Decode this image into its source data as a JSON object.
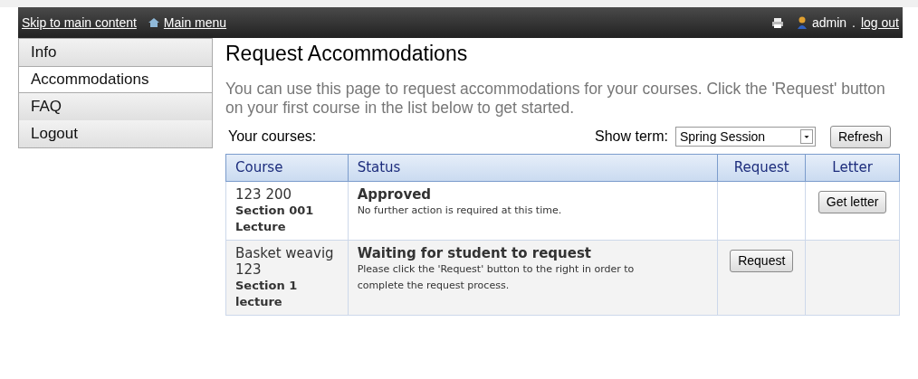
{
  "top_bar": {
    "skip_link": "Skip to main content",
    "main_menu": "Main menu",
    "user": "admin",
    "separator": ".",
    "logout": "log out"
  },
  "sidebar": {
    "items": [
      {
        "label": "Info",
        "selected": false
      },
      {
        "label": "Accommodations",
        "selected": true
      },
      {
        "label": "FAQ",
        "selected": false
      },
      {
        "label": "Logout",
        "selected": false
      }
    ]
  },
  "page": {
    "title": "Request Accommodations",
    "intro": "You can use this page to request accommodations for your courses. Click the 'Request' button on your first course in the list below to get started.",
    "courses_label": "Your courses:",
    "term_label": "Show term:",
    "term_value": "Spring Session",
    "refresh_button": "Refresh"
  },
  "table": {
    "columns": [
      "Course",
      "Status",
      "Request",
      "Letter"
    ],
    "rows": [
      {
        "course": "123 200",
        "section": "Section 001 Lecture",
        "status": "Approved",
        "status_note": "No further action is required at this time.",
        "letter_button": "Get letter"
      },
      {
        "course": "Basket weavig 123",
        "section": "Section 1 lecture",
        "status": "Waiting for student to request",
        "status_note": "Please click the 'Request' button to the right in order to complete the request process.",
        "request_button": "Request"
      }
    ]
  }
}
